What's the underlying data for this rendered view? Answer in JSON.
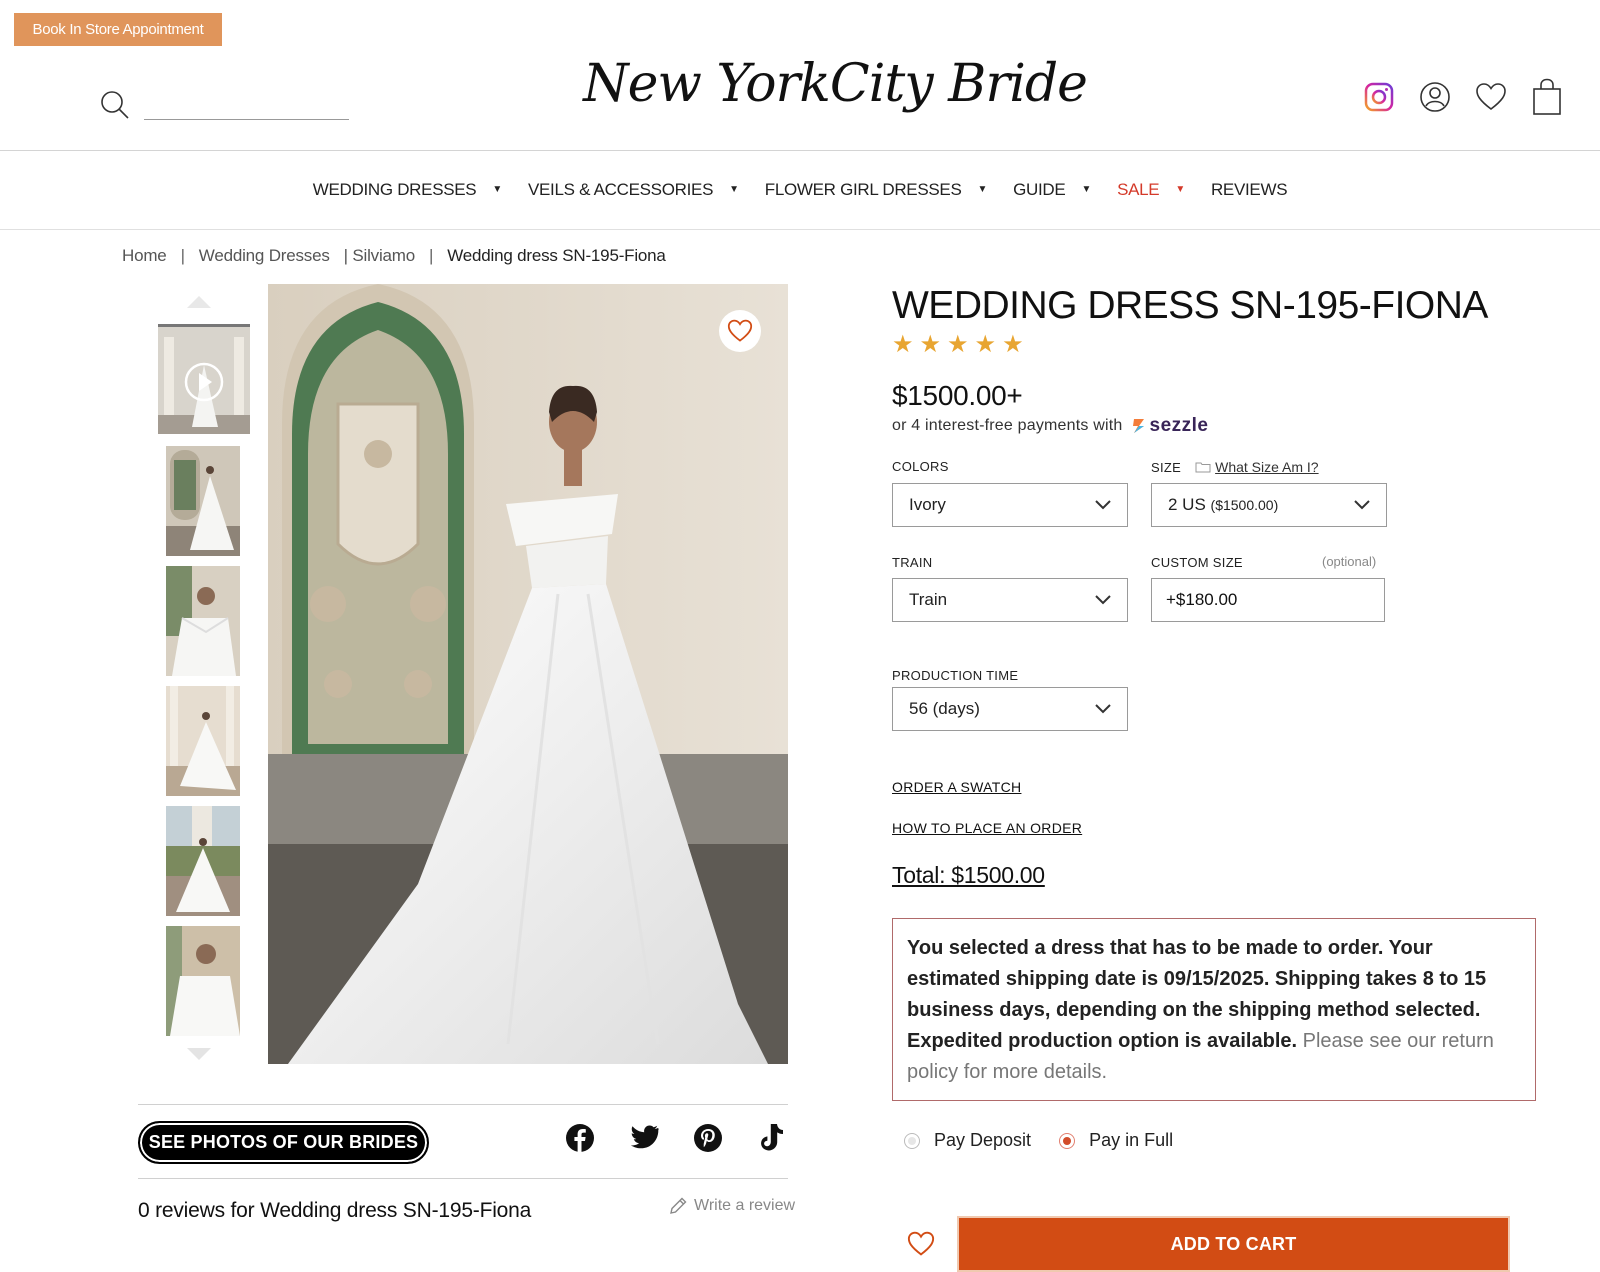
{
  "header": {
    "appointment_label": "Book In Store Appointment",
    "search_placeholder": "",
    "logo_text_left": "New York",
    "logo_text_right": "City Bride"
  },
  "nav": {
    "items": [
      {
        "label": "WEDDING DRESSES"
      },
      {
        "label": "VEILS & ACCESSORIES"
      },
      {
        "label": "FLOWER GIRL DRESSES"
      },
      {
        "label": "GUIDE"
      },
      {
        "label": "SALE"
      },
      {
        "label": "REVIEWS"
      }
    ]
  },
  "breadcrumb": {
    "home": "Home",
    "sep": "|",
    "category": "Wedding Dresses",
    "brand": "| Silviamo",
    "current": "Wedding dress SN-195-Fiona"
  },
  "product": {
    "title": "WEDDING DRESS SN-195-FIONA",
    "rating": 5,
    "price": "$1500.00+",
    "installments": "or 4 interest-free payments with",
    "sezzle": "sezzle"
  },
  "options": {
    "colors_label": "COLORS",
    "colors_value": "Ivory",
    "size_label": "SIZE",
    "size_help": "What Size Am I?",
    "size_value": "2 US",
    "size_price": "($1500.00)",
    "train_label": "TRAIN",
    "train_value": "Train",
    "custom_label": "CUSTOM SIZE",
    "custom_optional": "(optional)",
    "custom_value": "+$180.00",
    "production_label": "PRODUCTION TIME",
    "production_value": "56 (days)"
  },
  "links": {
    "swatch": "ORDER A SWATCH",
    "how_to": "HOW TO PLACE AN ORDER"
  },
  "total": "Total: $1500.00",
  "notice": {
    "bold": "You selected a dress that has to be made to order. Your estimated shipping date is 09/15/2025. Shipping takes 8 to 15 business days, depending on the shipping method selected. Expedited production option is available.",
    "light": "Please see our return policy for more details."
  },
  "payment": {
    "deposit": "Pay Deposit",
    "full": "Pay in Full",
    "selected": "full"
  },
  "cart_label": "ADD TO CART",
  "gallery": {
    "brides_label": "SEE PHOTOS OF OUR BRIDES",
    "reviews_text": "0 reviews for Wedding dress SN-195-Fiona",
    "write_review": "Write a review"
  },
  "colors": {
    "accent": "#d24c14",
    "appointment": "#e0955b",
    "sale": "#d43a2a",
    "star": "#e8a531"
  }
}
